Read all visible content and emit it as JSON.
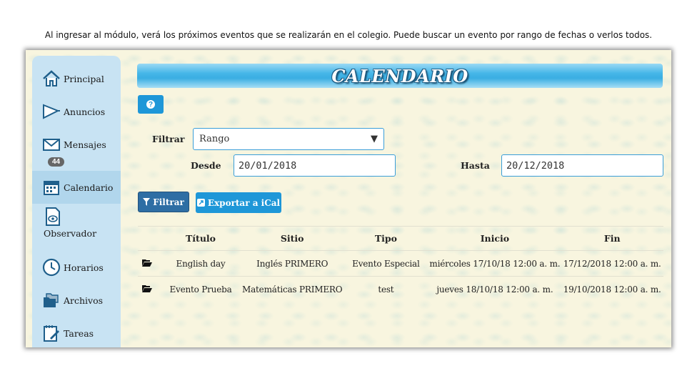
{
  "caption": "Al ingresar al módulo, verá los próximos eventos que se realizarán en el colegio. Puede buscar un evento por rango de fechas o verlos todos.",
  "sidebar": {
    "items": [
      {
        "label": "Principal",
        "icon": "home-icon"
      },
      {
        "label": "Anuncios",
        "icon": "megaphone-icon"
      },
      {
        "label": "Mensajes",
        "icon": "envelope-icon",
        "badge": "44"
      },
      {
        "label": "Calendario",
        "icon": "calendar-icon",
        "active": true
      },
      {
        "label": "Observador",
        "icon": "eye-document-icon"
      },
      {
        "label": "Horarios",
        "icon": "clock-icon"
      },
      {
        "label": "Archivos",
        "icon": "folders-icon"
      },
      {
        "label": "Tareas",
        "icon": "notepad-pen-icon"
      }
    ]
  },
  "header": {
    "title": "CALENDARIO"
  },
  "help": {
    "label": "?"
  },
  "filter": {
    "label": "Filtrar",
    "selected": "Rango",
    "from_label": "Desde",
    "from_value": "20/01/2018",
    "to_label": "Hasta",
    "to_value": "20/12/2018"
  },
  "buttons": {
    "filter": "Filtrar",
    "export": "Exportar a iCal"
  },
  "table": {
    "headers": [
      "Título",
      "Sitio",
      "Tipo",
      "Inicio",
      "Fin"
    ],
    "rows": [
      [
        "English day",
        "Inglés PRIMERO",
        "Evento Especial",
        "miércoles 17/10/18 12:00 a. m.",
        "17/12/2018 12:00 a. m."
      ],
      [
        "Evento Prueba",
        "Matemáticas PRIMERO",
        "test",
        "jueves 18/10/18 12:00 a. m.",
        "19/10/2018 12:00 a. m."
      ]
    ]
  },
  "colors": {
    "accent": "#1e97d8",
    "sidebar": "#c8e3f3",
    "filter_button": "#2e6ea4",
    "background": "#f8f5df"
  }
}
